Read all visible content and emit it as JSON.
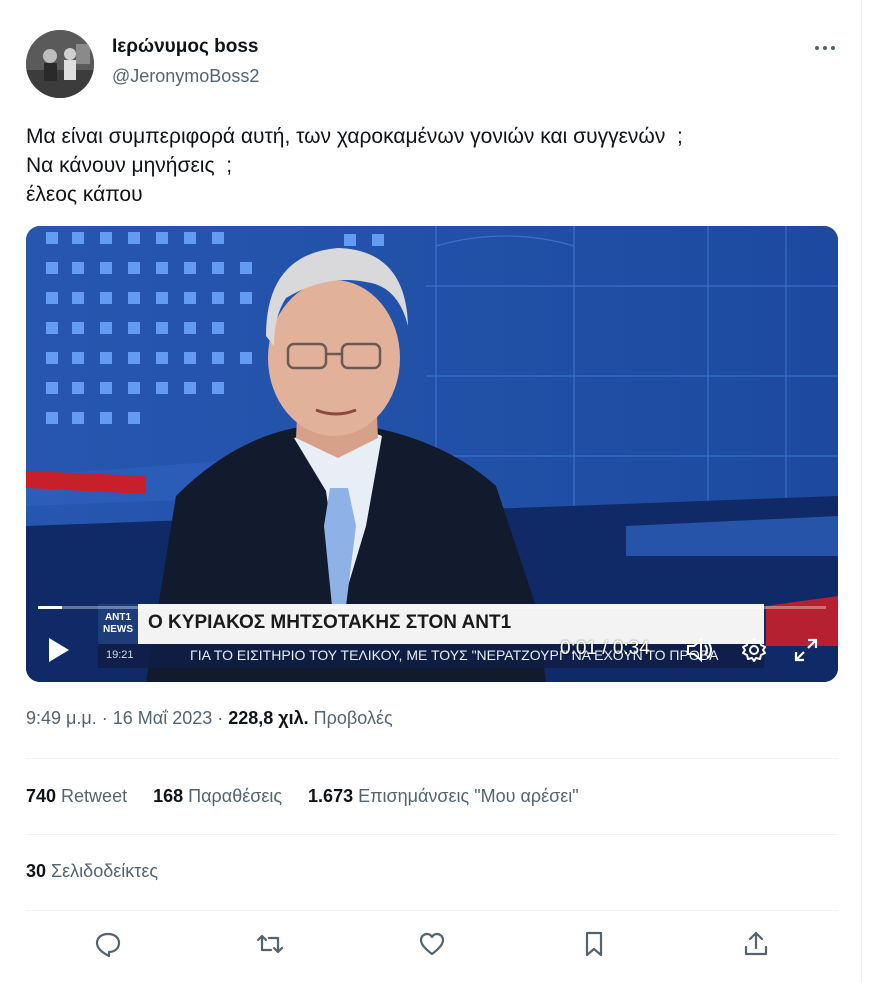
{
  "tweet": {
    "author_name": "Ιερώνυμος boss",
    "author_handle": "@JeronymoBoss2",
    "more_icon": "more-horizontal-icon",
    "text_lines": [
      "Μα είναι συμπεριφορά αυτή, των χαροκαμένων γονιών και συγγενών  ;",
      "Να κάνουν μηνήσεις  ;",
      "έλεος κάπου"
    ],
    "timestamp": "9:49 μ.μ. · 16 Μαΐ 2023 · ",
    "views_count": "228,8 χιλ.",
    "views_label": " Προβολές"
  },
  "video": {
    "channel_logo": "ANT1 NEWS",
    "headline": "Ο ΚΥΡΙΑΚΟΣ ΜΗΤΣΟΤΑΚΗΣ ΣΤΟΝ ΑΝΤ1",
    "ticker_time": "19:21",
    "ticker_text": "ΓΙΑ ΤΟ ΕΙΣΙΤΗΡΙΟ ΤΟΥ ΤΕΛΙΚΟΥ, ΜΕ ΤΟΥΣ \"ΝΕΡΑΤΖΟΥΡΙ\" ΝΑ ΕΧΟΥΝ ΤΟ ΠΡΟΒΑ",
    "time_display": "0:01 / 0:34",
    "progress_fraction": 0.03,
    "icons": [
      "play-icon",
      "volume-icon",
      "settings-gear-icon",
      "fullscreen-icon"
    ]
  },
  "stats": {
    "retweets_count": "740",
    "retweets_label": " Retweet",
    "quotes_count": "168",
    "quotes_label": " Παραθέσεις",
    "likes_count": "1.673",
    "likes_label": " Επισημάνσεις \"Μου αρέσει\"",
    "bookmarks_count": "30",
    "bookmarks_label": " Σελιδοδείκτες"
  },
  "actions": [
    "reply-icon",
    "retweet-icon",
    "like-icon",
    "bookmark-icon",
    "share-icon"
  ],
  "colors": {
    "text_primary": "#0f1419",
    "text_secondary": "#536471",
    "divider": "#eff3f4"
  }
}
